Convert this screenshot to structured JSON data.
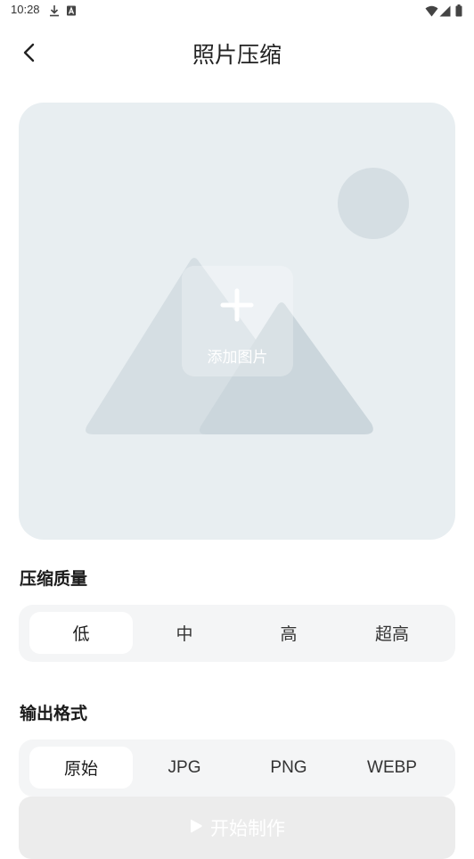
{
  "status_bar": {
    "time": "10:28",
    "icons": [
      "download-icon",
      "font-a-icon",
      "wifi-icon",
      "signal-icon",
      "battery-icon"
    ]
  },
  "header": {
    "back_icon": "chevron-left-icon",
    "title": "照片压缩"
  },
  "picker": {
    "icon": "plus-icon",
    "label": "添加图片"
  },
  "quality": {
    "title": "压缩质量",
    "options": [
      "低",
      "中",
      "高",
      "超高"
    ],
    "selected": "低"
  },
  "format": {
    "title": "输出格式",
    "options": [
      "原始",
      "JPG",
      "PNG",
      "WEBP"
    ],
    "selected": "原始"
  },
  "start_button": {
    "icon": "play-icon",
    "label": "开始制作"
  },
  "colors": {
    "picker_bg": "#e8eef1",
    "segment_bg": "#f4f5f6",
    "button_bg": "#ececec"
  }
}
